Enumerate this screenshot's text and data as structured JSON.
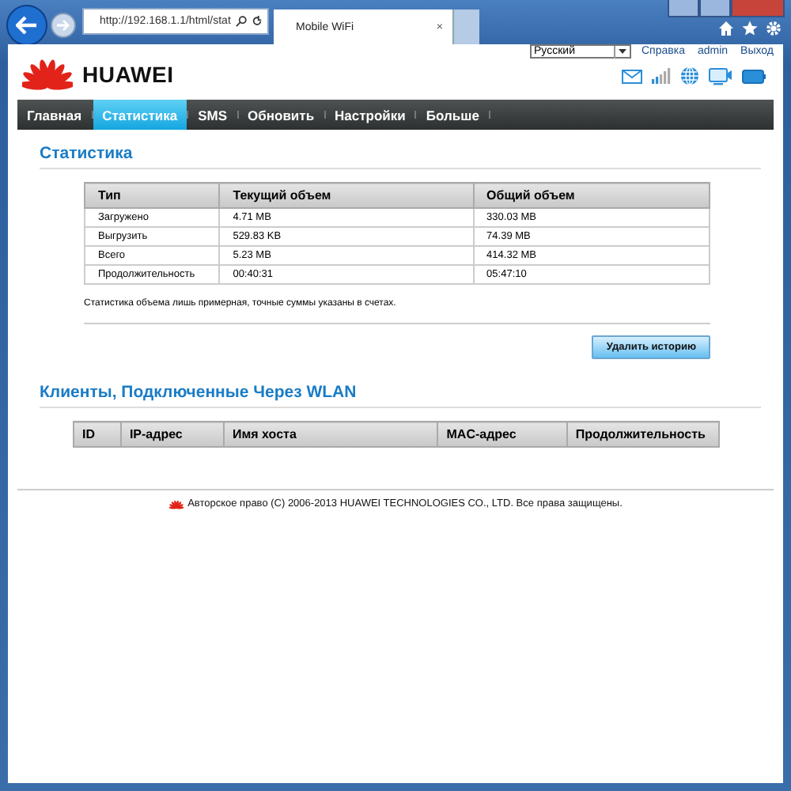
{
  "browser": {
    "address": "http://192.168.1.1/html/stat",
    "tab_title": "Mobile WiFi",
    "tab_close": "×"
  },
  "header": {
    "logo": "HUAWEI",
    "language": "Русский",
    "links": [
      "Справка",
      "admin",
      "Выход"
    ]
  },
  "nav": [
    {
      "label": "Главная",
      "selected": false
    },
    {
      "label": "Статистика",
      "selected": true
    },
    {
      "label": "SMS",
      "selected": false
    },
    {
      "label": "Обновить",
      "selected": false
    },
    {
      "label": "Настройки",
      "selected": false
    },
    {
      "label": "Больше",
      "selected": false
    }
  ],
  "statistics": {
    "title": "Статистика",
    "columns": [
      "Тип",
      "Текущий объем",
      "Общий объем"
    ],
    "rows": [
      [
        "Загружено",
        "4.71 MB",
        "330.03 MB"
      ],
      [
        "Выгрузить",
        "529.83 KB",
        "74.39 MB"
      ],
      [
        "Всего",
        "5.23 MB",
        "414.32 MB"
      ],
      [
        "Продолжительность",
        "00:40:31",
        "05:47:10"
      ]
    ],
    "note": "Статистика объема лишь примерная, точные суммы указаны в счетах.",
    "button": "Удалить историю"
  },
  "clients": {
    "title": "Клиенты, Подключенные Через WLAN",
    "columns": [
      "ID",
      "IP-адрес",
      "Имя хоста",
      "MAC-адрес",
      "Продолжительность"
    ]
  },
  "footer": "Авторское право (C) 2006-2013 HUAWEI TECHNOLOGIES CO., LTD. Все права защищены."
}
